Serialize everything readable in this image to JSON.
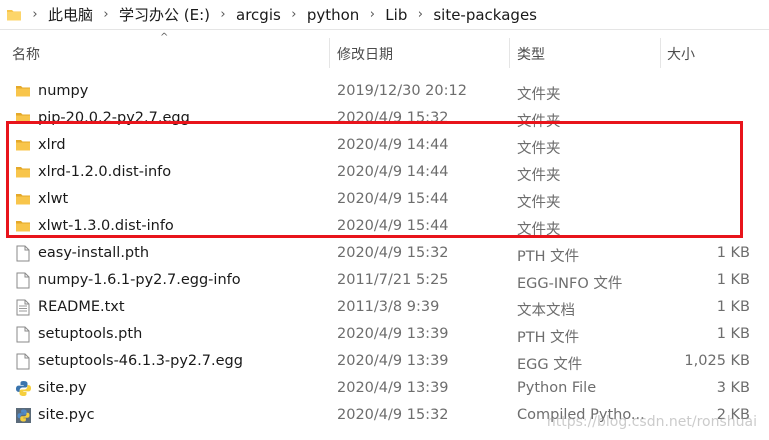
{
  "address_bar": {
    "crumbs": [
      "此电脑",
      "学习办公 (E:)",
      "arcgis",
      "python",
      "Lib",
      "site-packages"
    ]
  },
  "columns": {
    "name": "名称",
    "date": "修改日期",
    "type": "类型",
    "size": "大小"
  },
  "files": [
    {
      "icon": "folder-icon",
      "name": "numpy",
      "date": "2019/12/30 20:12",
      "type": "文件夹",
      "size": ""
    },
    {
      "icon": "folder-icon",
      "name": "pip-20.0.2-py2.7.egg",
      "date": "2020/4/9 15:32",
      "type": "文件夹",
      "size": ""
    },
    {
      "icon": "folder-icon",
      "name": "xlrd",
      "date": "2020/4/9 14:44",
      "type": "文件夹",
      "size": ""
    },
    {
      "icon": "folder-icon",
      "name": "xlrd-1.2.0.dist-info",
      "date": "2020/4/9 14:44",
      "type": "文件夹",
      "size": ""
    },
    {
      "icon": "folder-icon",
      "name": "xlwt",
      "date": "2020/4/9 15:44",
      "type": "文件夹",
      "size": ""
    },
    {
      "icon": "folder-icon",
      "name": "xlwt-1.3.0.dist-info",
      "date": "2020/4/9 15:44",
      "type": "文件夹",
      "size": ""
    },
    {
      "icon": "file-icon",
      "name": "easy-install.pth",
      "date": "2020/4/9 15:32",
      "type": "PTH 文件",
      "size": "1 KB"
    },
    {
      "icon": "file-icon",
      "name": "numpy-1.6.1-py2.7.egg-info",
      "date": "2011/7/21 5:25",
      "type": "EGG-INFO 文件",
      "size": "1 KB"
    },
    {
      "icon": "text-file-icon",
      "name": "README.txt",
      "date": "2011/3/8 9:39",
      "type": "文本文档",
      "size": "1 KB"
    },
    {
      "icon": "file-icon",
      "name": "setuptools.pth",
      "date": "2020/4/9 13:39",
      "type": "PTH 文件",
      "size": "1 KB"
    },
    {
      "icon": "file-icon",
      "name": "setuptools-46.1.3-py2.7.egg",
      "date": "2020/4/9 13:39",
      "type": "EGG 文件",
      "size": "1,025 KB"
    },
    {
      "icon": "python-file-icon",
      "name": "site.py",
      "date": "2020/4/9 13:39",
      "type": "Python File",
      "size": "3 KB"
    },
    {
      "icon": "python-compiled-icon",
      "name": "site.pyc",
      "date": "2020/4/9 15:32",
      "type": "Compiled Pytho...",
      "size": "2 KB"
    }
  ],
  "watermark": "https://blog.csdn.net/ronshuai",
  "colors": {
    "folder": "#f8c54b",
    "highlight": "#e8141b",
    "secondary_text": "#6d6d6d"
  }
}
